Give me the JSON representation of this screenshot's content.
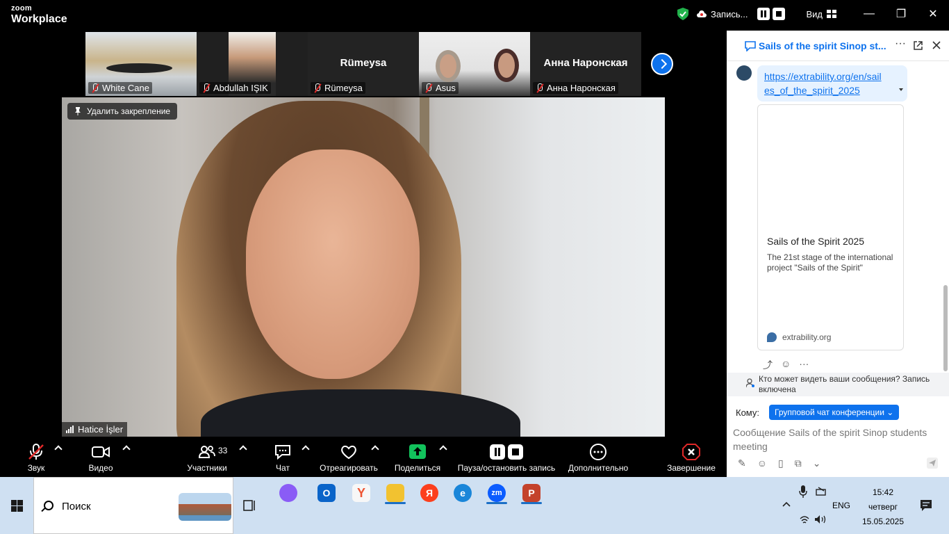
{
  "titlebar": {
    "logo_small": "zoom",
    "logo_big": "Workplace",
    "recording_label": "Запись...",
    "view_label": "Вид",
    "minimize": "—",
    "maximize": "❐",
    "close": "✕"
  },
  "participants": [
    {
      "name": "White Cane",
      "big_name": ""
    },
    {
      "name": "Abdullah IŞIK",
      "big_name": ""
    },
    {
      "name": "Rümeysa",
      "big_name": "Rümeysa"
    },
    {
      "name": "Asus",
      "big_name": ""
    },
    {
      "name": "Анна Наронская",
      "big_name": "Анна Наронская"
    }
  ],
  "main_video": {
    "unpin_label": "Удалить закрепление",
    "speaker_name": "Hatice İşler"
  },
  "toolbar": {
    "audio": "Звук",
    "video": "Видео",
    "participants": "Участники",
    "participants_count": "33",
    "chat": "Чат",
    "react": "Отреагировать",
    "share": "Поделиться",
    "record": "Пауза/остановить запись",
    "more": "Дополнительно",
    "end": "Завершение"
  },
  "chat": {
    "title": "Sails of the spirit Sinop st...",
    "link_line1": "https://extrability.org/en/sail",
    "link_line2": "es_of_the_spirit_2025",
    "preview_title": "Sails of the Spirit 2025",
    "preview_desc": "The 21st stage of the international project \"Sails of the Spirit\"",
    "preview_site": "extrability.org",
    "visibility_notice": "Кто может видеть ваши сообщения? Запись включена",
    "to_label": "Кому:",
    "to_target": "Групповой чат конференции",
    "compose_placeholder": "Сообщение Sails of the spirit Sinop students meeting"
  },
  "taskbar": {
    "search_label": "Поиск",
    "lang": "ENG",
    "time": "15:42",
    "day": "четверг",
    "date": "15.05.2025"
  },
  "colors": {
    "accent": "#0e72ed",
    "share_green": "#12c25c",
    "end_red": "#e02828",
    "taskbar_bg": "#cfe0f2"
  }
}
